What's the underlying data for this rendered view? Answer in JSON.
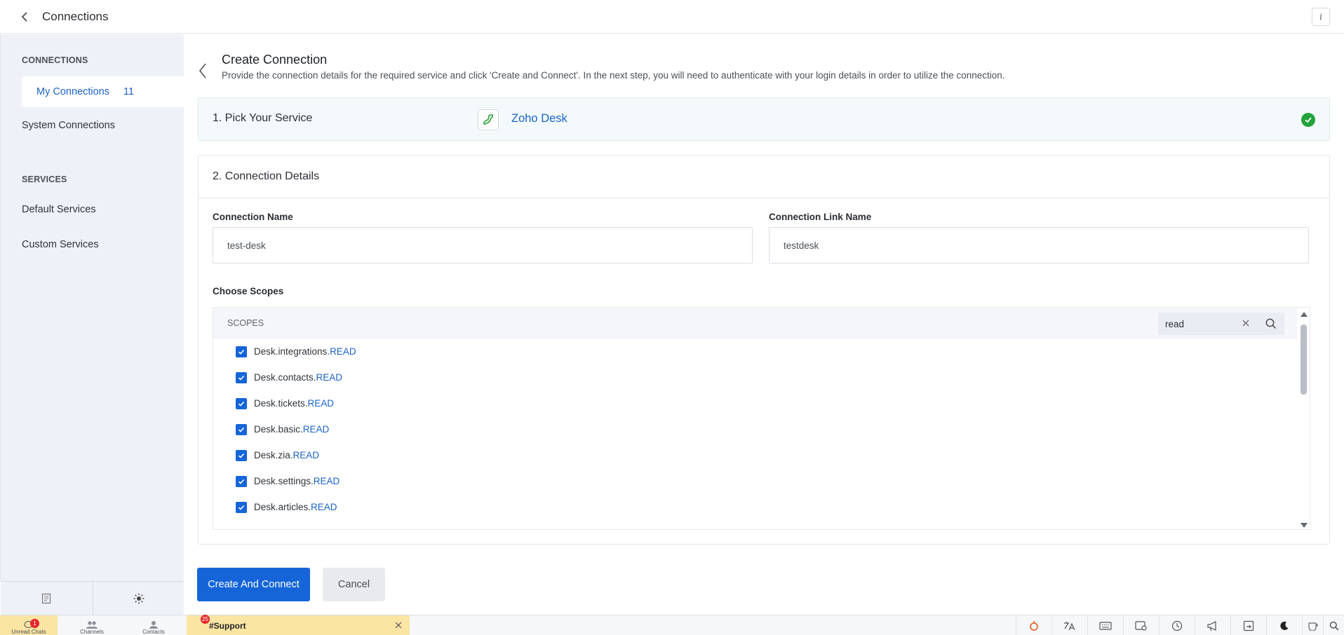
{
  "header": {
    "title": "Connections",
    "info_label": "i"
  },
  "sidebar": {
    "sections": [
      {
        "title": "CONNECTIONS"
      },
      {
        "title": "SERVICES"
      }
    ],
    "active_item": {
      "label": "My Connections",
      "count": "11"
    },
    "items": [
      {
        "label": "System Connections"
      },
      {
        "label": "Default Services"
      },
      {
        "label": "Custom Services"
      }
    ]
  },
  "page": {
    "title": "Create Connection",
    "description": "Provide the connection details for the required service and click 'Create and Connect'. In the next step, you will need to authenticate with your login details in order to utilize the connection."
  },
  "step1": {
    "label": "1. Pick Your Service",
    "service_name": "Zoho Desk"
  },
  "step2": {
    "label": "2. Connection Details",
    "connection_name_label": "Connection Name",
    "connection_name_value": "test-desk",
    "link_name_label": "Connection Link Name",
    "link_name_value": "testdesk",
    "scopes_label": "Choose Scopes",
    "scopes_header": "SCOPES",
    "search_value": "read",
    "scopes": [
      {
        "prefix": "Desk.integrations.",
        "perm": "READ",
        "checked": true
      },
      {
        "prefix": "Desk.contacts.",
        "perm": "READ",
        "checked": true
      },
      {
        "prefix": "Desk.tickets.",
        "perm": "READ",
        "checked": true
      },
      {
        "prefix": "Desk.basic.",
        "perm": "READ",
        "checked": true
      },
      {
        "prefix": "Desk.zia.",
        "perm": "READ",
        "checked": true
      },
      {
        "prefix": "Desk.settings.",
        "perm": "READ",
        "checked": true
      },
      {
        "prefix": "Desk.articles.",
        "perm": "READ",
        "checked": true
      }
    ]
  },
  "actions": {
    "primary": "Create And Connect",
    "cancel": "Cancel"
  },
  "statusbar": {
    "tabs": [
      {
        "label": "Unread Chats",
        "badge": "1"
      },
      {
        "label": "Channels"
      },
      {
        "label": "Contacts"
      }
    ],
    "chat": {
      "name": "#Support",
      "badge": "25"
    }
  },
  "colors": {
    "accent": "#1565d8",
    "link": "#1a63c9",
    "success": "#22a33b",
    "sidebar_bg": "#eef2f8"
  }
}
